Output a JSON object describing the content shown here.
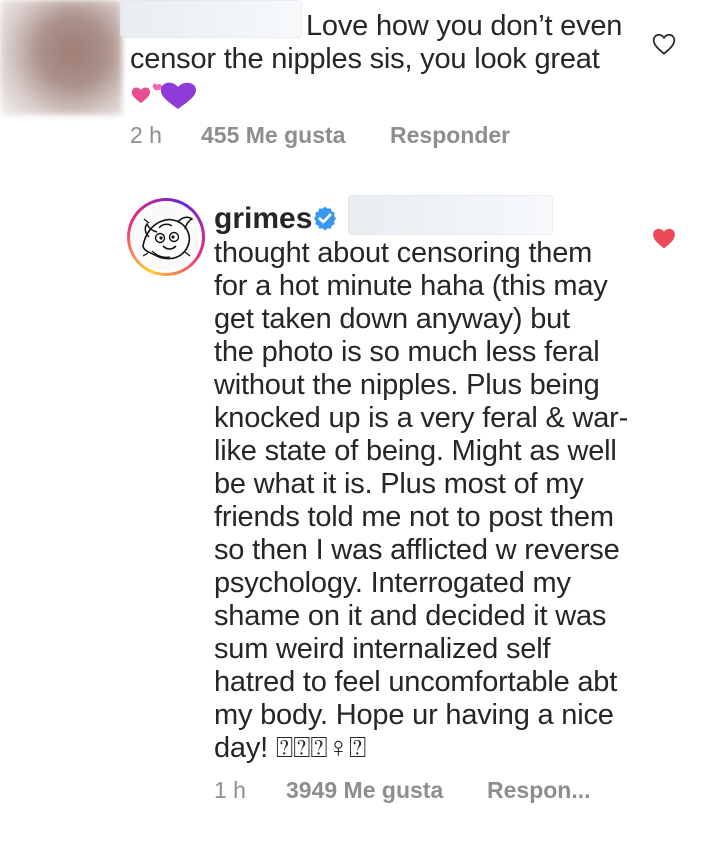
{
  "first_comment": {
    "text_lines": [
      "Love how you don’t even",
      "censor the nipples sis, you look great"
    ],
    "time": "2 h",
    "likes": "455 Me gusta",
    "reply_label": "Responder",
    "emoji_icon": "pink-purple-hearts-icon"
  },
  "reply_comment": {
    "username": "grimes",
    "text_lines": [
      "thought about censoring them",
      "for a hot minute haha (this may",
      "get taken down anyway) but",
      "the photo is so much less feral",
      "without the nipples.  Plus being",
      "knocked up is a very feral & war-",
      "like state of being.  Might as well",
      "be what it is.  Plus most of my",
      "friends told me not to post them",
      "so then I was afflicted w reverse",
      "psychology.  Interrogated my",
      "shame on it and decided it was",
      "sum weird internalized self",
      "hatred to feel uncomfortable abt",
      "my body.  Hope ur having a nice",
      "day! ⍰⍰⍰♀⍰"
    ],
    "time": "1 h",
    "likes": "3949 Me gusta",
    "reply_label": "Respon..."
  },
  "colors": {
    "text": "#262626",
    "meta": "#8e8e8e",
    "heart_liked": "#ed4956",
    "verified": "#3897f0"
  }
}
